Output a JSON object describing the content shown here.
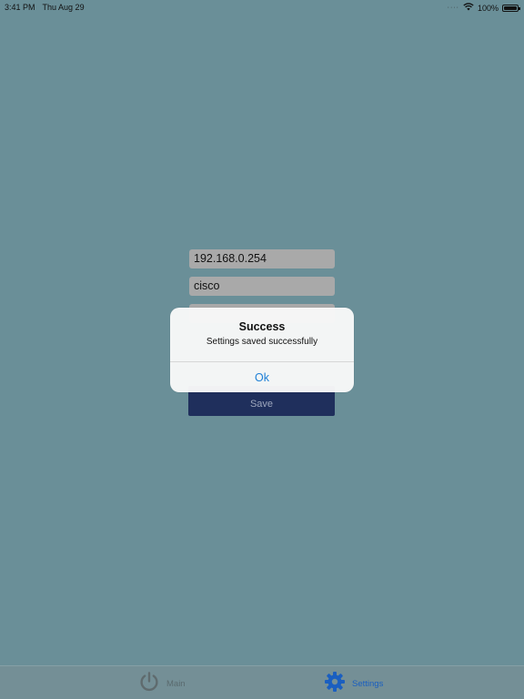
{
  "status_bar": {
    "time": "3:41 PM",
    "date": "Thu Aug 29",
    "battery": "100%",
    "battery_level": 1.0
  },
  "form": {
    "ip_address": "192.168.0.254",
    "username": "cisco",
    "password": "",
    "save_label": "Save"
  },
  "alert": {
    "title": "Success",
    "message": "Settings saved successfully",
    "ok_label": "Ok"
  },
  "tab_bar": {
    "tabs": [
      {
        "label": "Main",
        "icon": "power-icon",
        "selected": false
      },
      {
        "label": "Settings",
        "icon": "gear-icon",
        "selected": true
      }
    ]
  },
  "colors": {
    "background": "#6a8f98",
    "save_button": "#1f2f5c",
    "accent": "#1a5fc0",
    "alert_button": "#1d7fd6"
  }
}
